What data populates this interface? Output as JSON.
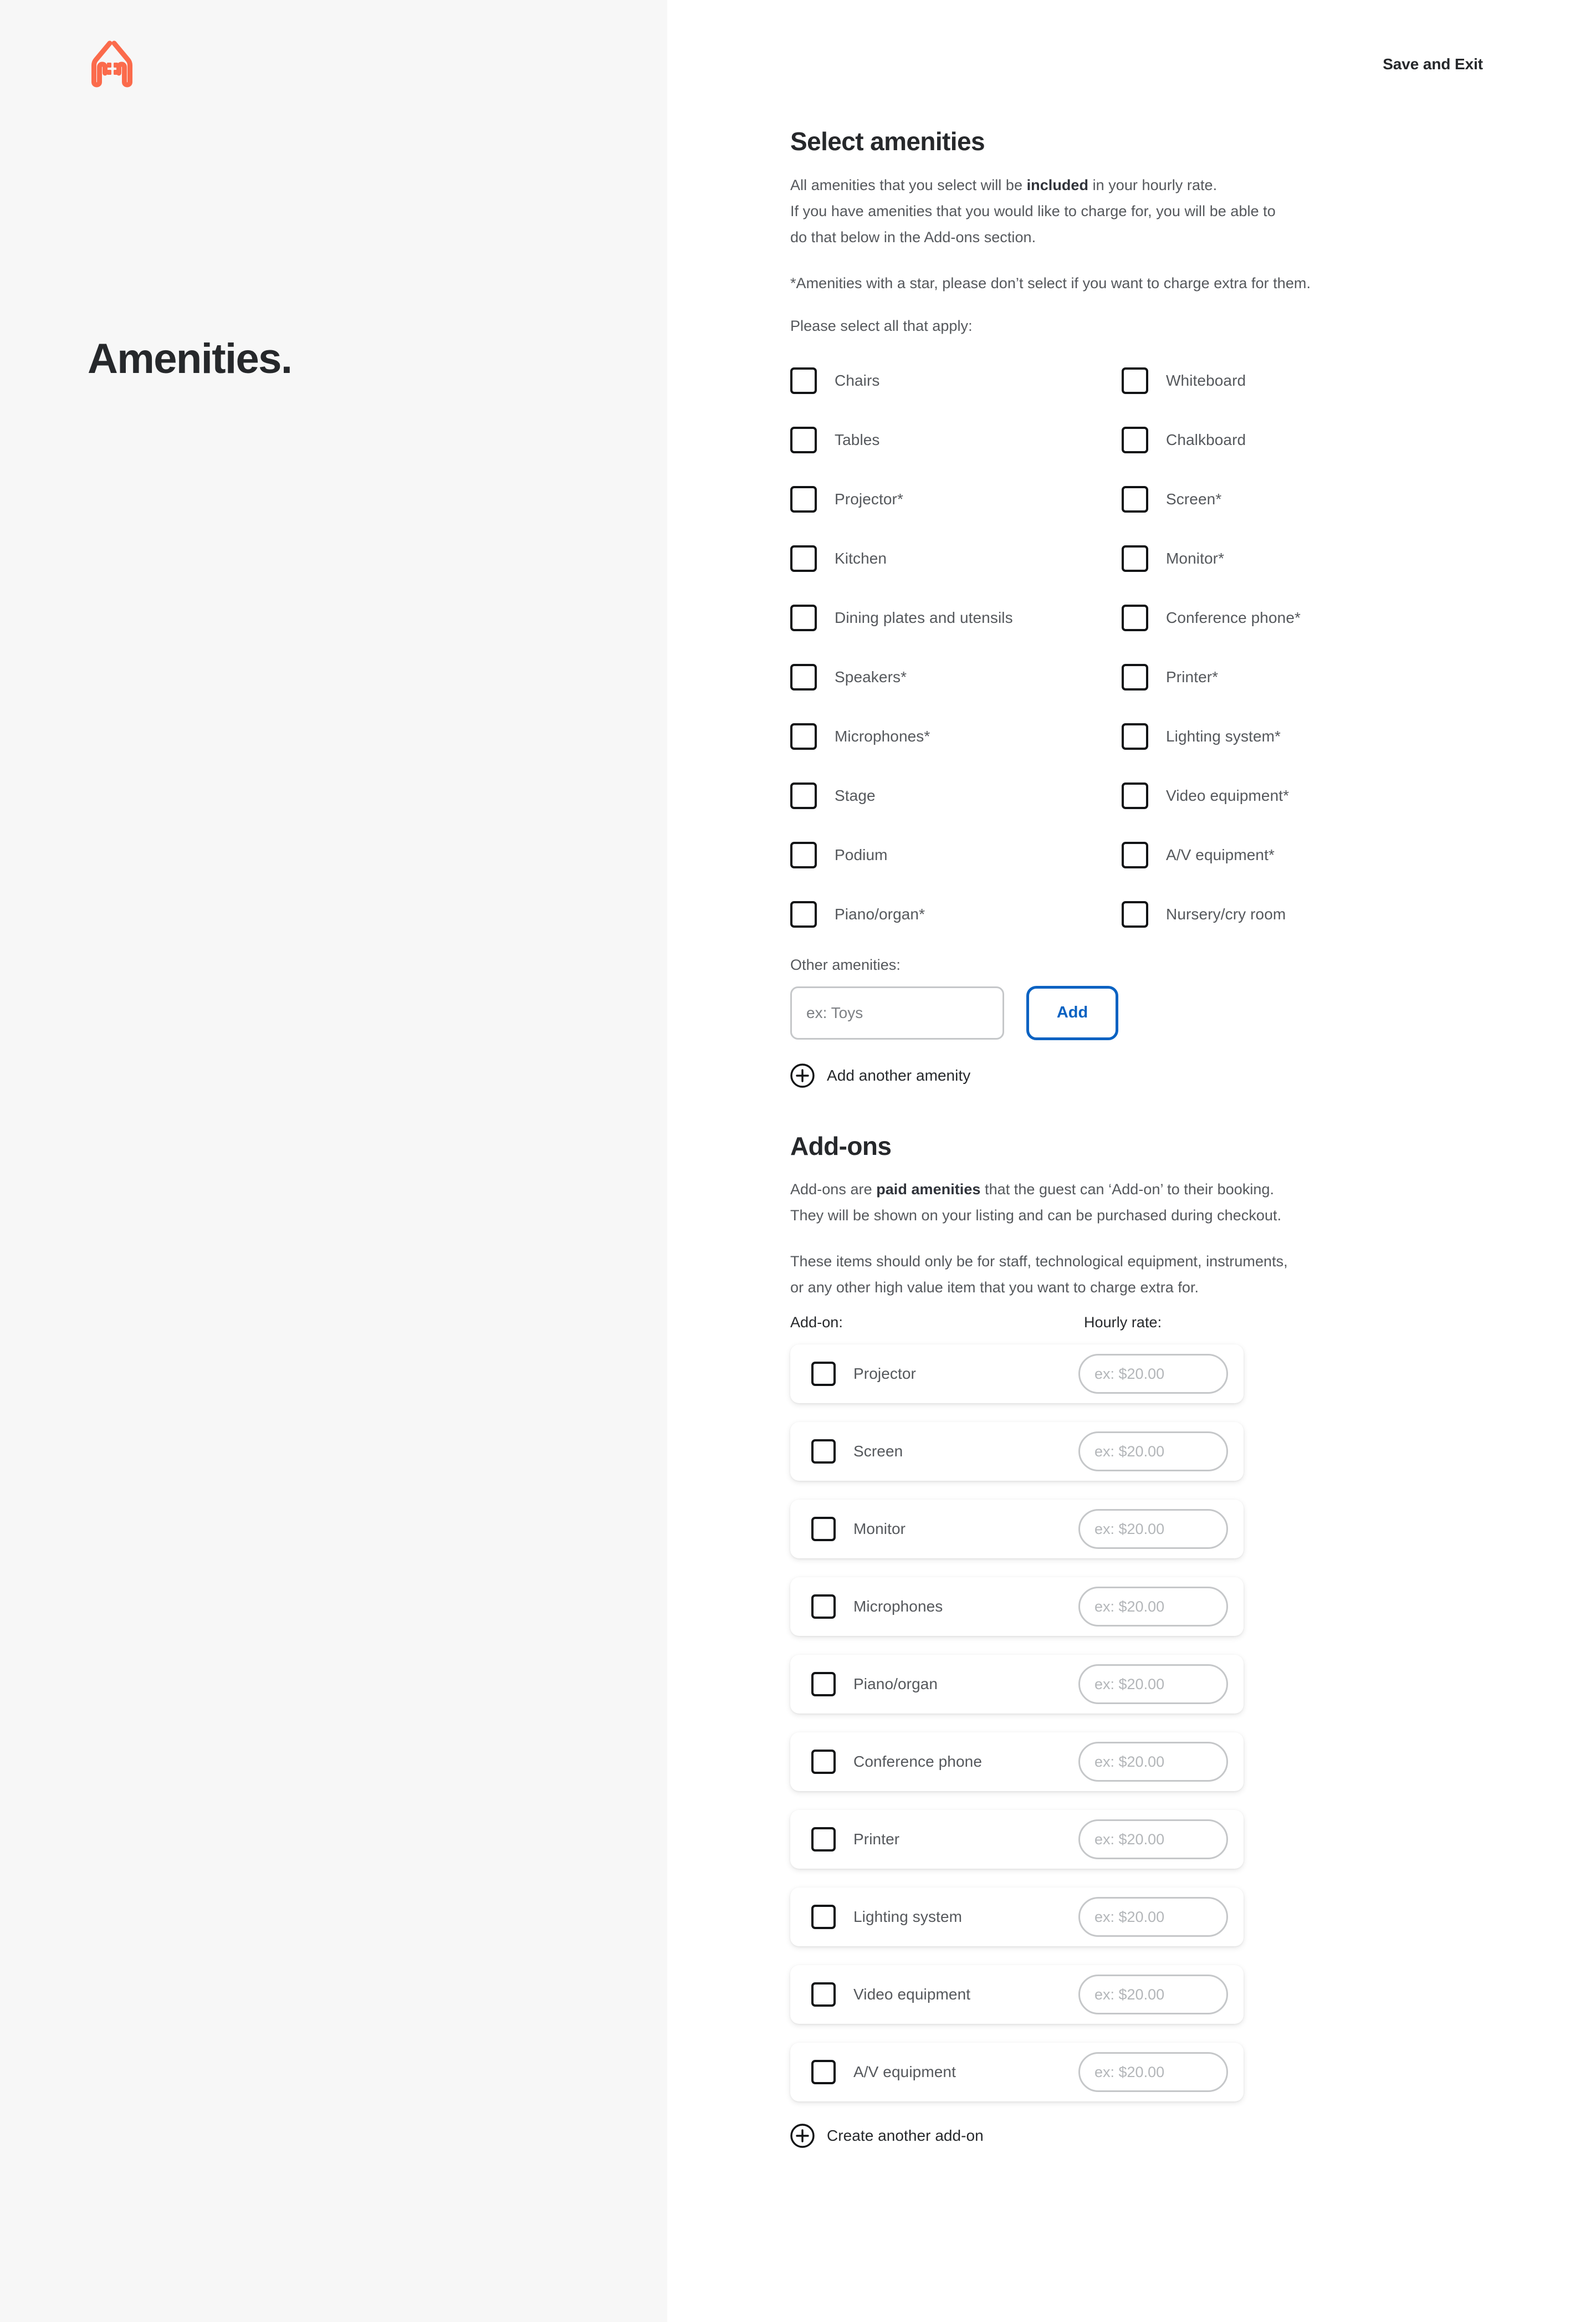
{
  "brand": {
    "logo_icon": "hands-house-logo-icon",
    "logo_color": "#FB6B4C"
  },
  "header": {
    "save_exit_label": "Save and Exit"
  },
  "left": {
    "page_title": "Amenities."
  },
  "select_amenities": {
    "title": "Select amenities",
    "paragraph1_pre": "All amenities that you select will be ",
    "paragraph1_bold": "included",
    "paragraph1_post": " in your hourly rate.",
    "paragraph1_line2": "If you have amenities that you would like to charge for, you will be able to",
    "paragraph1_line3": "do that below in the Add-ons section.",
    "star_note": "*Amenities with a star, please don’t select if you want to charge extra for them.",
    "select_all_label": "Please select all that apply:",
    "items_left": [
      "Chairs",
      "Tables",
      "Projector*",
      "Kitchen",
      "Dining plates and utensils",
      "Speakers*",
      "Microphones*",
      "Stage",
      "Podium",
      "Piano/organ*"
    ],
    "items_right": [
      "Whiteboard",
      "Chalkboard",
      "Screen*",
      "Monitor*",
      "Conference phone*",
      "Printer*",
      "Lighting system*",
      "Video equipment*",
      "A/V equipment*",
      "Nursery/cry room"
    ]
  },
  "other_amenities": {
    "label": "Other amenities:",
    "input_value": "",
    "input_placeholder": "ex: Toys",
    "add_button_label": "Add",
    "add_button_color": "#0A62C2",
    "add_another_label": "Add another amenity",
    "plus_icon": "plus-circle-icon"
  },
  "addons": {
    "title": "Add-ons",
    "paragraph1_pre": "Add-ons are ",
    "paragraph1_bold": "paid amenities",
    "paragraph1_post": " that the guest can ‘Add-on’ to their booking.",
    "paragraph1_line2": "They will be shown on your listing and can be purchased during checkout.",
    "paragraph2_line1": "These items should only be for staff, technological equipment, instruments,",
    "paragraph2_line2": "or any other high value item that you want to charge extra for.",
    "col_addon_label": "Add-on:",
    "col_rate_label": "Hourly rate:",
    "rate_placeholder": "ex: $20.00",
    "rows": [
      {
        "label": "Projector",
        "rate_value": ""
      },
      {
        "label": "Screen",
        "rate_value": ""
      },
      {
        "label": "Monitor",
        "rate_value": ""
      },
      {
        "label": "Microphones",
        "rate_value": ""
      },
      {
        "label": "Piano/organ",
        "rate_value": ""
      },
      {
        "label": "Conference phone",
        "rate_value": ""
      },
      {
        "label": "Printer",
        "rate_value": ""
      },
      {
        "label": "Lighting system",
        "rate_value": ""
      },
      {
        "label": "Video equipment",
        "rate_value": ""
      },
      {
        "label": "A/V equipment",
        "rate_value": ""
      }
    ],
    "create_another_label": "Create another add-on",
    "plus_icon": "plus-circle-icon"
  }
}
